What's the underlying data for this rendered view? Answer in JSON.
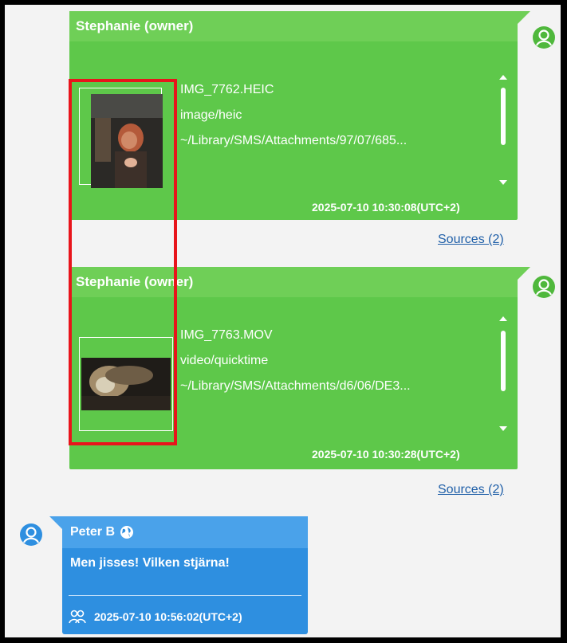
{
  "messages": [
    {
      "sender": "Stephanie (owner)",
      "filename": "IMG_7762.HEIC",
      "mimetype": "image/heic",
      "path": "~/Library/SMS/Attachments/97/07/685...",
      "timestamp": "2025-07-10 10:30:08(UTC+2)",
      "sources": "Sources (2)"
    },
    {
      "sender": "Stephanie (owner)",
      "filename": "IMG_7763.MOV",
      "mimetype": "video/quicktime",
      "path": "~/Library/SMS/Attachments/d6/06/DE3...",
      "timestamp": "2025-07-10 10:30:28(UTC+2)",
      "sources": "Sources (2)"
    }
  ],
  "reply": {
    "sender": "Peter B",
    "text": "Men jisses! Vilken stjärna!",
    "timestamp": "2025-07-10 10:56:02(UTC+2)"
  },
  "icons": {
    "avatar": "user-circle-icon",
    "globe": "globe-icon",
    "participants": "participants-icon"
  },
  "colors": {
    "green_bubble": "#5ec84a",
    "green_header": "#6fcf57",
    "blue_bubble": "#2e8fe0",
    "highlight": "#e8141b",
    "link": "#1f5fa8"
  }
}
